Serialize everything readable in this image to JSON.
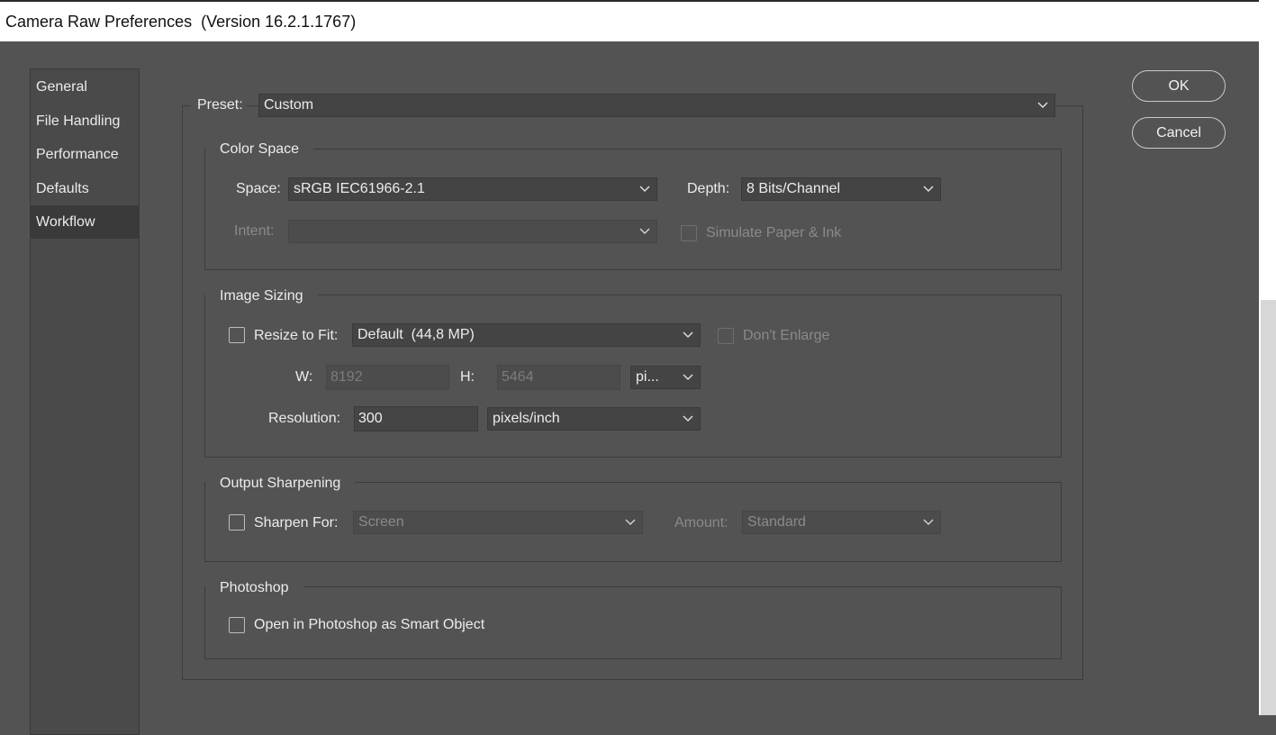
{
  "window": {
    "title": "Camera Raw Preferences  (Version 16.2.1.1767)"
  },
  "sidebar": {
    "items": [
      {
        "label": "General"
      },
      {
        "label": "File Handling"
      },
      {
        "label": "Performance"
      },
      {
        "label": "Defaults"
      },
      {
        "label": "Workflow",
        "active": true
      }
    ]
  },
  "preset": {
    "label": "Preset:",
    "value": "Custom"
  },
  "color_space": {
    "title": "Color Space",
    "space_label": "Space:",
    "space_value": "sRGB IEC61966-2.1",
    "depth_label": "Depth:",
    "depth_value": "8 Bits/Channel",
    "intent_label": "Intent:",
    "intent_value": "",
    "simulate_label": "Simulate Paper & Ink"
  },
  "image_sizing": {
    "title": "Image Sizing",
    "resize_label": "Resize to Fit:",
    "resize_value": "Default  (44,8 MP)",
    "dont_enlarge_label": "Don't Enlarge",
    "w_label": "W:",
    "w_value": "8192",
    "h_label": "H:",
    "h_value": "5464",
    "unit_value": "pi...",
    "resolution_label": "Resolution:",
    "resolution_value": "300",
    "resolution_unit": "pixels/inch"
  },
  "output_sharpening": {
    "title": "Output Sharpening",
    "sharpen_label": "Sharpen For:",
    "sharpen_value": "Screen",
    "amount_label": "Amount:",
    "amount_value": "Standard"
  },
  "photoshop": {
    "title": "Photoshop",
    "smart_object_label": "Open in Photoshop as Smart Object"
  },
  "buttons": {
    "ok": "OK",
    "cancel": "Cancel"
  }
}
